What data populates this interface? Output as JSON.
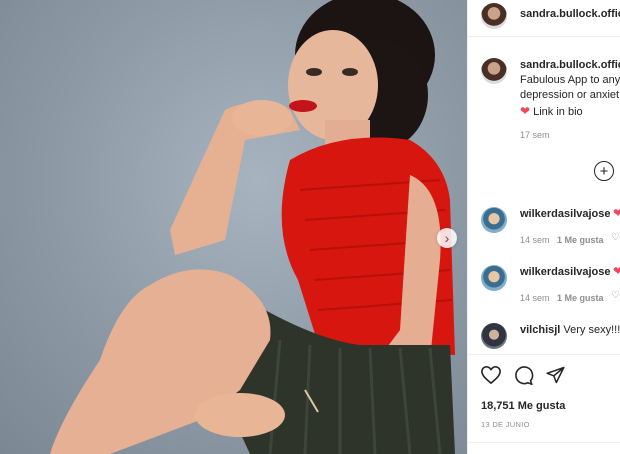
{
  "post_image": {
    "alt": ""
  },
  "header": {
    "username": "sandra.bullock.offici"
  },
  "caption": {
    "username": "sandra.bullock.offici",
    "line1": "Fabulous App to any",
    "line2": "depression or anxiet",
    "link_text": "Link in bio",
    "age": "17 sem"
  },
  "comments": [
    {
      "username": "wilkerdasilvajose",
      "text": "",
      "age": "14 sem",
      "likes": "1 Me gusta"
    },
    {
      "username": "wilkerdasilvajose",
      "text": "",
      "age": "14 sem",
      "likes": "1 Me gusta"
    },
    {
      "username": "vilchisjl",
      "text": "Very sexy!!!!"
    }
  ],
  "stats": {
    "likes": "18,751 Me gusta",
    "date": "13 DE JUNIO"
  },
  "colors": {
    "heart": "#ed4956",
    "muted": "#8e8e8e"
  },
  "icons": [
    "heart-icon",
    "comment-icon",
    "share-icon",
    "plus-circle-icon",
    "chevron-right-icon"
  ]
}
